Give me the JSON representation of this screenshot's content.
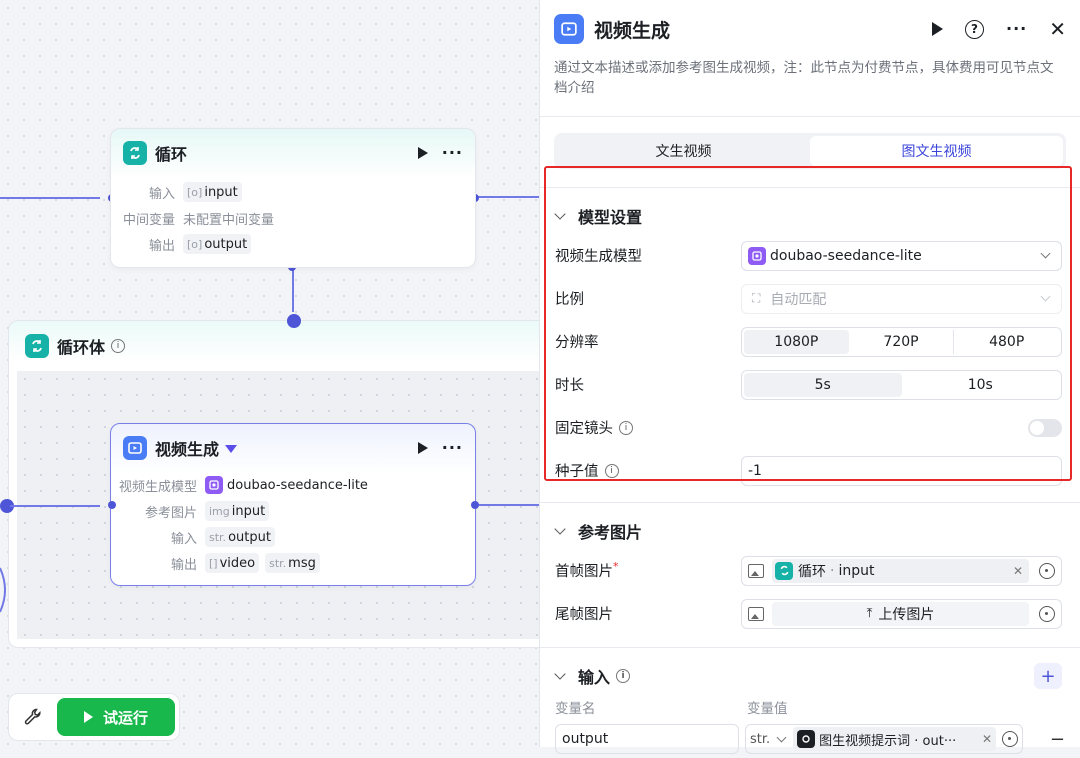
{
  "canvas": {
    "loop_node": {
      "title": "循环",
      "rows": [
        {
          "label": "输入",
          "chips": [
            {
              "prefix": "[o]",
              "text": "input"
            }
          ]
        },
        {
          "label": "中间变量",
          "text": "未配置中间变量"
        },
        {
          "label": "输出",
          "chips": [
            {
              "prefix": "[o]",
              "text": "output"
            }
          ]
        }
      ]
    },
    "loop_body": {
      "title": "循环体"
    },
    "video_node": {
      "title": "视频生成",
      "rows": [
        {
          "label": "视频生成模型",
          "model": "doubao-seedance-lite"
        },
        {
          "label": "参考图片",
          "chips": [
            {
              "prefix": "img",
              "text": "input"
            }
          ]
        },
        {
          "label": "输入",
          "chips": [
            {
              "prefix": "str.",
              "text": "output"
            }
          ]
        },
        {
          "label": "输出",
          "chips": [
            {
              "prefix": "[]",
              "text": "video"
            },
            {
              "prefix": "str.",
              "text": "msg"
            }
          ]
        }
      ]
    },
    "run_button": "试运行"
  },
  "panel": {
    "title": "视频生成",
    "description": "通过文本描述或添加参考图生成视频，注：此节点为付费节点，具体费用可见节点文档介绍",
    "tabs": [
      {
        "label": "文生视频",
        "active": false
      },
      {
        "label": "图文生视频",
        "active": true
      }
    ],
    "model_section": {
      "title": "模型设置",
      "model_label": "视频生成模型",
      "model_value": "doubao-seedance-lite",
      "ratio_label": "比例",
      "ratio_value": "自动匹配",
      "resolution_label": "分辨率",
      "resolutions": [
        "1080P",
        "720P",
        "480P"
      ],
      "resolution_selected": "1080P",
      "duration_label": "时长",
      "durations": [
        "5s",
        "10s"
      ],
      "duration_selected": "5s",
      "fixed_camera_label": "固定镜头",
      "fixed_camera_on": false,
      "seed_label": "种子值",
      "seed_value": "-1"
    },
    "ref_section": {
      "title": "参考图片",
      "first_frame_label": "首帧图片",
      "required_mark": "*",
      "first_frame_source": "循环",
      "first_frame_var": "input",
      "last_frame_label": "尾帧图片",
      "upload_label": "上传图片"
    },
    "input_section": {
      "title": "输入",
      "col_name": "变量名",
      "col_value": "变量值",
      "var_name": "output",
      "var_type": "str.",
      "var_ref": "图生视频提示词 · out···"
    }
  },
  "colors": {
    "accent": "#4e55d6",
    "loop_icon": "#17b2a7",
    "video_icon": "#4a7df5",
    "run": "#19b84c",
    "highlight": "#e62828"
  }
}
